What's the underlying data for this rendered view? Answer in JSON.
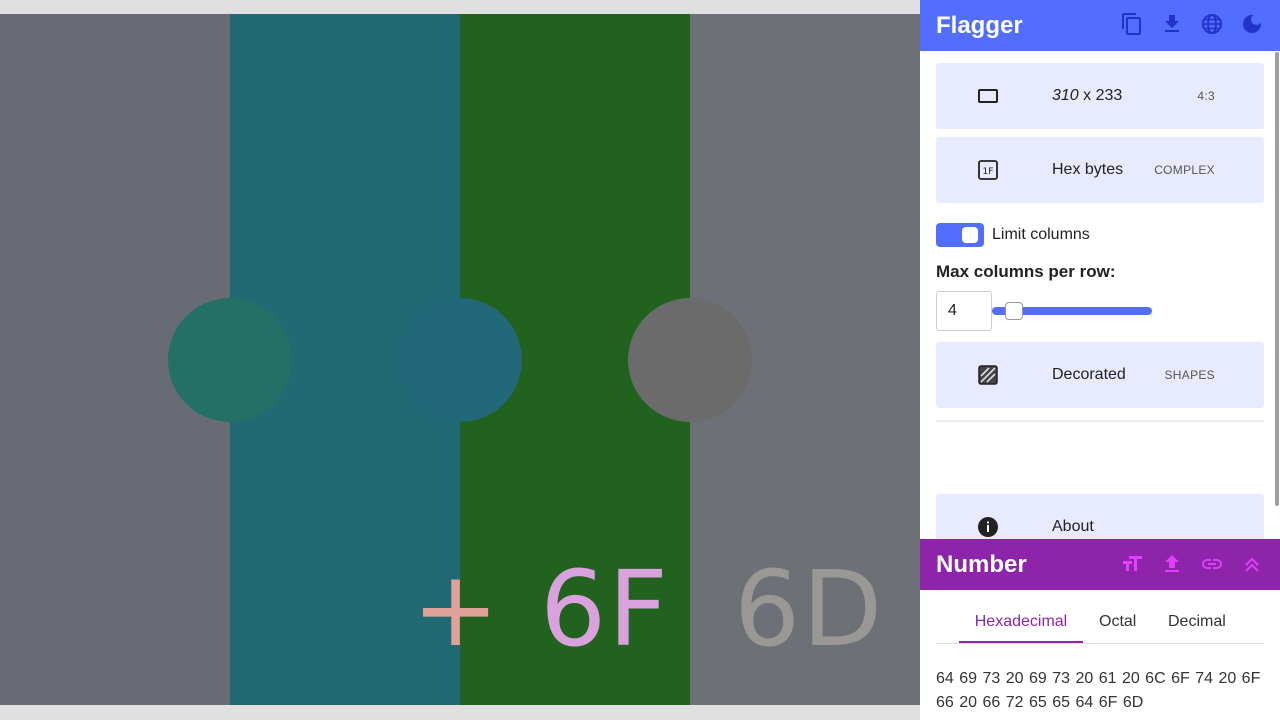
{
  "colors": {
    "background_gray": "#686b73",
    "stripe_teal": "#216a73",
    "stripe_green": "#21621f",
    "stripe_gray": "#6d7076",
    "dot_green": "#237066",
    "dot_teal": "#226878",
    "dot_gray": "#6b6b6b",
    "glyph_plus": "#e0a298",
    "glyph_6f": "#d9a2dd",
    "glyph_6d": "#9a9894",
    "accent_blue": "#536dfe",
    "accent_purple": "#8e24aa"
  },
  "canvas": {
    "glyphs": [
      "+",
      "6F",
      "6D"
    ]
  },
  "sidebar": {
    "title": "Flagger",
    "toolbar_icons": [
      "copy-icon",
      "download-icon",
      "globe-icon",
      "dark-mode-icon"
    ],
    "size_card": {
      "icon": "aspect-ratio-icon",
      "width": "310",
      "sep": " x ",
      "height": "233",
      "tag": "4:3"
    },
    "encoding_card": {
      "icon": "hex-1f-icon",
      "label": "Hex bytes",
      "tag": "COMPLEX"
    },
    "limit_columns": {
      "label": "Limit columns",
      "enabled": true
    },
    "max_columns": {
      "label": "Max columns per row:",
      "value": "4",
      "slider_fraction": 0.06
    },
    "style_card": {
      "icon": "pattern-icon",
      "label": "Decorated",
      "tag": "SHAPES"
    },
    "about_card": {
      "icon": "info-icon",
      "label": "About"
    }
  },
  "number_panel": {
    "title": "Number",
    "toolbar_icons": [
      "text-size-icon",
      "upload-icon",
      "link-icon",
      "collapse-icon"
    ],
    "tabs": [
      "Hexadecimal",
      "Octal",
      "Decimal"
    ],
    "active_tab": "Hexadecimal",
    "output": "64 69 73 20 69 73 20 61 20 6C 6F 74 20 6F 66 20 66 72 65 65 64 6F 6D"
  }
}
